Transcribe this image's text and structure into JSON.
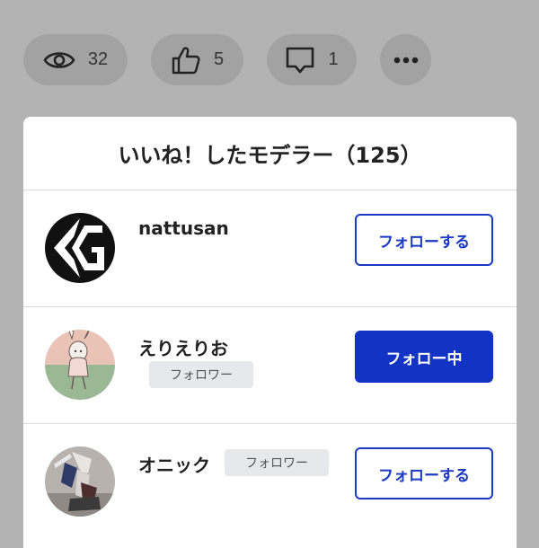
{
  "stats": {
    "views": "32",
    "likes": "5",
    "comments": "1"
  },
  "modal": {
    "title": "いいね！したモデラー（125）"
  },
  "users": [
    {
      "name": "nattusan",
      "follow_label": "フォローする",
      "badge": ""
    },
    {
      "name": "えりえりお",
      "follow_label": "フォロー中",
      "badge": "フォロワー"
    },
    {
      "name": "オニック",
      "follow_label": "フォローする",
      "badge": "フォロワー"
    }
  ],
  "colors": {
    "background": "#b3b3b3",
    "pill": "#a2a2a2",
    "accent": "#1233c4",
    "badge": "#e6e8eb"
  },
  "icons": [
    "eye-icon",
    "thumbs-up-icon",
    "comment-icon",
    "more-icon"
  ]
}
